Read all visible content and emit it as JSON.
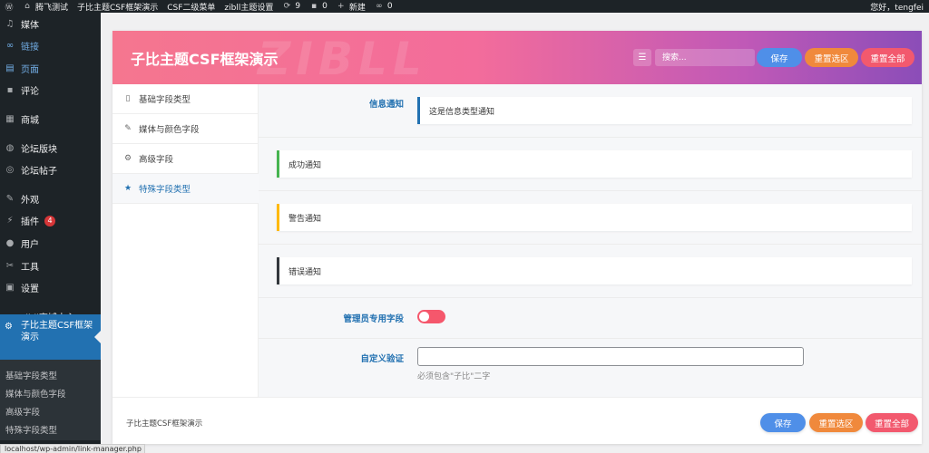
{
  "topbar": {
    "site_name": "腾飞测试",
    "menu1": "子比主题CSF框架演示",
    "menu2": "CSF二级菜单",
    "menu3": "zibll主题设置",
    "updates_count": "9",
    "comments_count": "0",
    "new_label": "新建",
    "links_count": "0",
    "greeting": "您好，tengfei"
  },
  "sidebar": {
    "items": [
      {
        "label": "媒体",
        "icon": "media-icon"
      },
      {
        "label": "链接",
        "icon": "link-icon"
      },
      {
        "label": "页面",
        "icon": "page-icon"
      },
      {
        "label": "评论",
        "icon": "comment-icon"
      },
      {
        "label": "商城",
        "icon": "shop-icon"
      },
      {
        "label": "论坛版块",
        "icon": "forum-icon"
      },
      {
        "label": "论坛帖子",
        "icon": "forum-post-icon"
      },
      {
        "label": "外观",
        "icon": "appearance-icon"
      },
      {
        "label": "插件",
        "icon": "plugin-icon",
        "badge": "4"
      },
      {
        "label": "用户",
        "icon": "user-icon"
      },
      {
        "label": "工具",
        "icon": "tool-icon"
      },
      {
        "label": "设置",
        "icon": "settings-icon"
      },
      {
        "label": "zibll商城中心",
        "icon": "shop-center-icon"
      }
    ],
    "current": {
      "label_line1": "子比主题CSF框架",
      "label_line2": "演示"
    },
    "submenu": [
      "基础字段类型",
      "媒体与颜色字段",
      "高级字段",
      "特殊字段类型"
    ]
  },
  "panel": {
    "title": "子比主题CSF框架演示",
    "watermark": "ZIBLL",
    "search_placeholder": "搜索...",
    "save_label": "保存",
    "reset_section_label": "重置选区",
    "reset_all_label": "重置全部"
  },
  "nav": {
    "items": [
      {
        "label": "基础字段类型",
        "icon": "document-icon"
      },
      {
        "label": "媒体与颜色字段",
        "icon": "brush-icon"
      },
      {
        "label": "高级字段",
        "icon": "gears-icon"
      },
      {
        "label": "特殊字段类型",
        "icon": "star-icon"
      }
    ]
  },
  "content": {
    "info_label": "信息通知",
    "info_text": "这是信息类型通知",
    "success_text": "成功通知",
    "warning_text": "警告通知",
    "error_text": "错误通知",
    "admin_field_label": "管理员专用字段",
    "custom_validate_label": "自定义验证",
    "custom_validate_value": "",
    "custom_validate_help": "必须包含\"子比\"二字",
    "colors": {
      "info": "#2271b1",
      "success": "#46b450",
      "warning": "#ffb900",
      "error": "#32373c",
      "toggle": "#f5576c"
    }
  },
  "footer": {
    "text": "子比主题CSF框架演示",
    "save_label": "保存",
    "reset_section_label": "重置选区",
    "reset_all_label": "重置全部"
  },
  "statusbar": {
    "url": "localhost/wp-admin/link-manager.php"
  }
}
